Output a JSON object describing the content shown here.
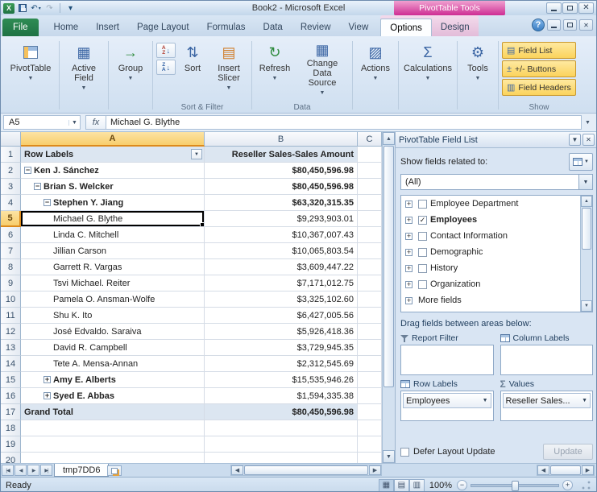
{
  "titlebar": {
    "title": "Book2 - Microsoft Excel",
    "contextual_tool": "PivotTable Tools"
  },
  "tabs": {
    "file": "File",
    "main": [
      "Home",
      "Insert",
      "Page Layout",
      "Formulas",
      "Data",
      "Review",
      "View"
    ],
    "contextual": [
      "Options",
      "Design"
    ],
    "active": "Options"
  },
  "ribbon": {
    "buttons": {
      "pivottable": "PivotTable",
      "active_field": "Active Field",
      "group": "Group",
      "sort": "Sort",
      "insert_slicer": "Insert Slicer",
      "refresh": "Refresh",
      "change_data_source": "Change Data Source",
      "actions": "Actions",
      "calculations": "Calculations",
      "tools": "Tools",
      "field_list": "Field List",
      "plus_minus_buttons": "+/- Buttons",
      "field_headers": "Field Headers"
    },
    "group_labels": {
      "sort_filter": "Sort & Filter",
      "data": "Data",
      "show": "Show"
    }
  },
  "formula_bar": {
    "name_box": "A5",
    "fx": "fx",
    "value": "Michael G. Blythe"
  },
  "grid": {
    "col_headers": [
      "A",
      "B",
      "C"
    ],
    "selected_cell": "A5",
    "rows": [
      {
        "n": 1,
        "type": "header",
        "a": "Row Labels",
        "b": "Reseller Sales-Sales Amount",
        "aBold": true,
        "bBold": true
      },
      {
        "n": 2,
        "a": "Ken J. Sánchez",
        "b": "$80,450,596.98",
        "indent": 0,
        "exp": "minus",
        "aBold": true,
        "bBold": true
      },
      {
        "n": 3,
        "a": "Brian S. Welcker",
        "b": "$80,450,596.98",
        "indent": 1,
        "exp": "minus",
        "aBold": true,
        "bBold": true
      },
      {
        "n": 4,
        "a": "Stephen Y. Jiang",
        "b": "$63,320,315.35",
        "indent": 2,
        "exp": "minus",
        "aBold": true,
        "bBold": true
      },
      {
        "n": 5,
        "a": "Michael G. Blythe",
        "b": "$9,293,903.01",
        "indent": 3,
        "selected": true
      },
      {
        "n": 6,
        "a": "Linda C. Mitchell",
        "b": "$10,367,007.43",
        "indent": 3
      },
      {
        "n": 7,
        "a": "Jillian Carson",
        "b": "$10,065,803.54",
        "indent": 3
      },
      {
        "n": 8,
        "a": "Garrett R. Vargas",
        "b": "$3,609,447.22",
        "indent": 3
      },
      {
        "n": 9,
        "a": "Tsvi Michael. Reiter",
        "b": "$7,171,012.75",
        "indent": 3
      },
      {
        "n": 10,
        "a": "Pamela O. Ansman-Wolfe",
        "b": "$3,325,102.60",
        "indent": 3
      },
      {
        "n": 11,
        "a": "Shu K. Ito",
        "b": "$6,427,005.56",
        "indent": 3
      },
      {
        "n": 12,
        "a": "José Edvaldo. Saraiva",
        "b": "$5,926,418.36",
        "indent": 3
      },
      {
        "n": 13,
        "a": "David R. Campbell",
        "b": "$3,729,945.35",
        "indent": 3
      },
      {
        "n": 14,
        "a": "Tete A. Mensa-Annan",
        "b": "$2,312,545.69",
        "indent": 3
      },
      {
        "n": 15,
        "a": "Amy E. Alberts",
        "b": "$15,535,946.26",
        "indent": 2,
        "exp": "plus",
        "aBold": true
      },
      {
        "n": 16,
        "a": "Syed E. Abbas",
        "b": "$1,594,335.38",
        "indent": 2,
        "exp": "plus",
        "aBold": true
      },
      {
        "n": 17,
        "type": "total",
        "a": "Grand Total",
        "b": "$80,450,596.98",
        "aBold": true,
        "bBold": true
      },
      {
        "n": 18
      },
      {
        "n": 19
      },
      {
        "n": 20
      }
    ]
  },
  "sheet": {
    "tab": "tmp7DD6"
  },
  "status": {
    "ready": "Ready",
    "zoom": "100%"
  },
  "pane": {
    "title": "PivotTable Field List",
    "show_fields_label": "Show fields related to:",
    "filter_value": "(All)",
    "fields": [
      {
        "label": "Employee Department",
        "checkbox": true,
        "checked": false
      },
      {
        "label": "Employees",
        "checkbox": true,
        "checked": true,
        "bold": true
      },
      {
        "label": "Contact Information",
        "checkbox": true,
        "checked": false
      },
      {
        "label": "Demographic",
        "checkbox": true,
        "checked": false
      },
      {
        "label": "History",
        "checkbox": true,
        "checked": false
      },
      {
        "label": "Organization",
        "checkbox": true,
        "checked": false
      },
      {
        "label": "More fields",
        "checkbox": false
      }
    ],
    "drag_label": "Drag fields between areas below:",
    "areas": {
      "report_filter": {
        "label": "Report Filter",
        "items": []
      },
      "column_labels": {
        "label": "Column Labels",
        "items": []
      },
      "row_labels": {
        "label": "Row Labels",
        "items": [
          "Employees"
        ]
      },
      "values": {
        "label": "Values",
        "items": [
          "Reseller Sales..."
        ]
      }
    },
    "defer_label": "Defer Layout Update",
    "update_label": "Update"
  }
}
